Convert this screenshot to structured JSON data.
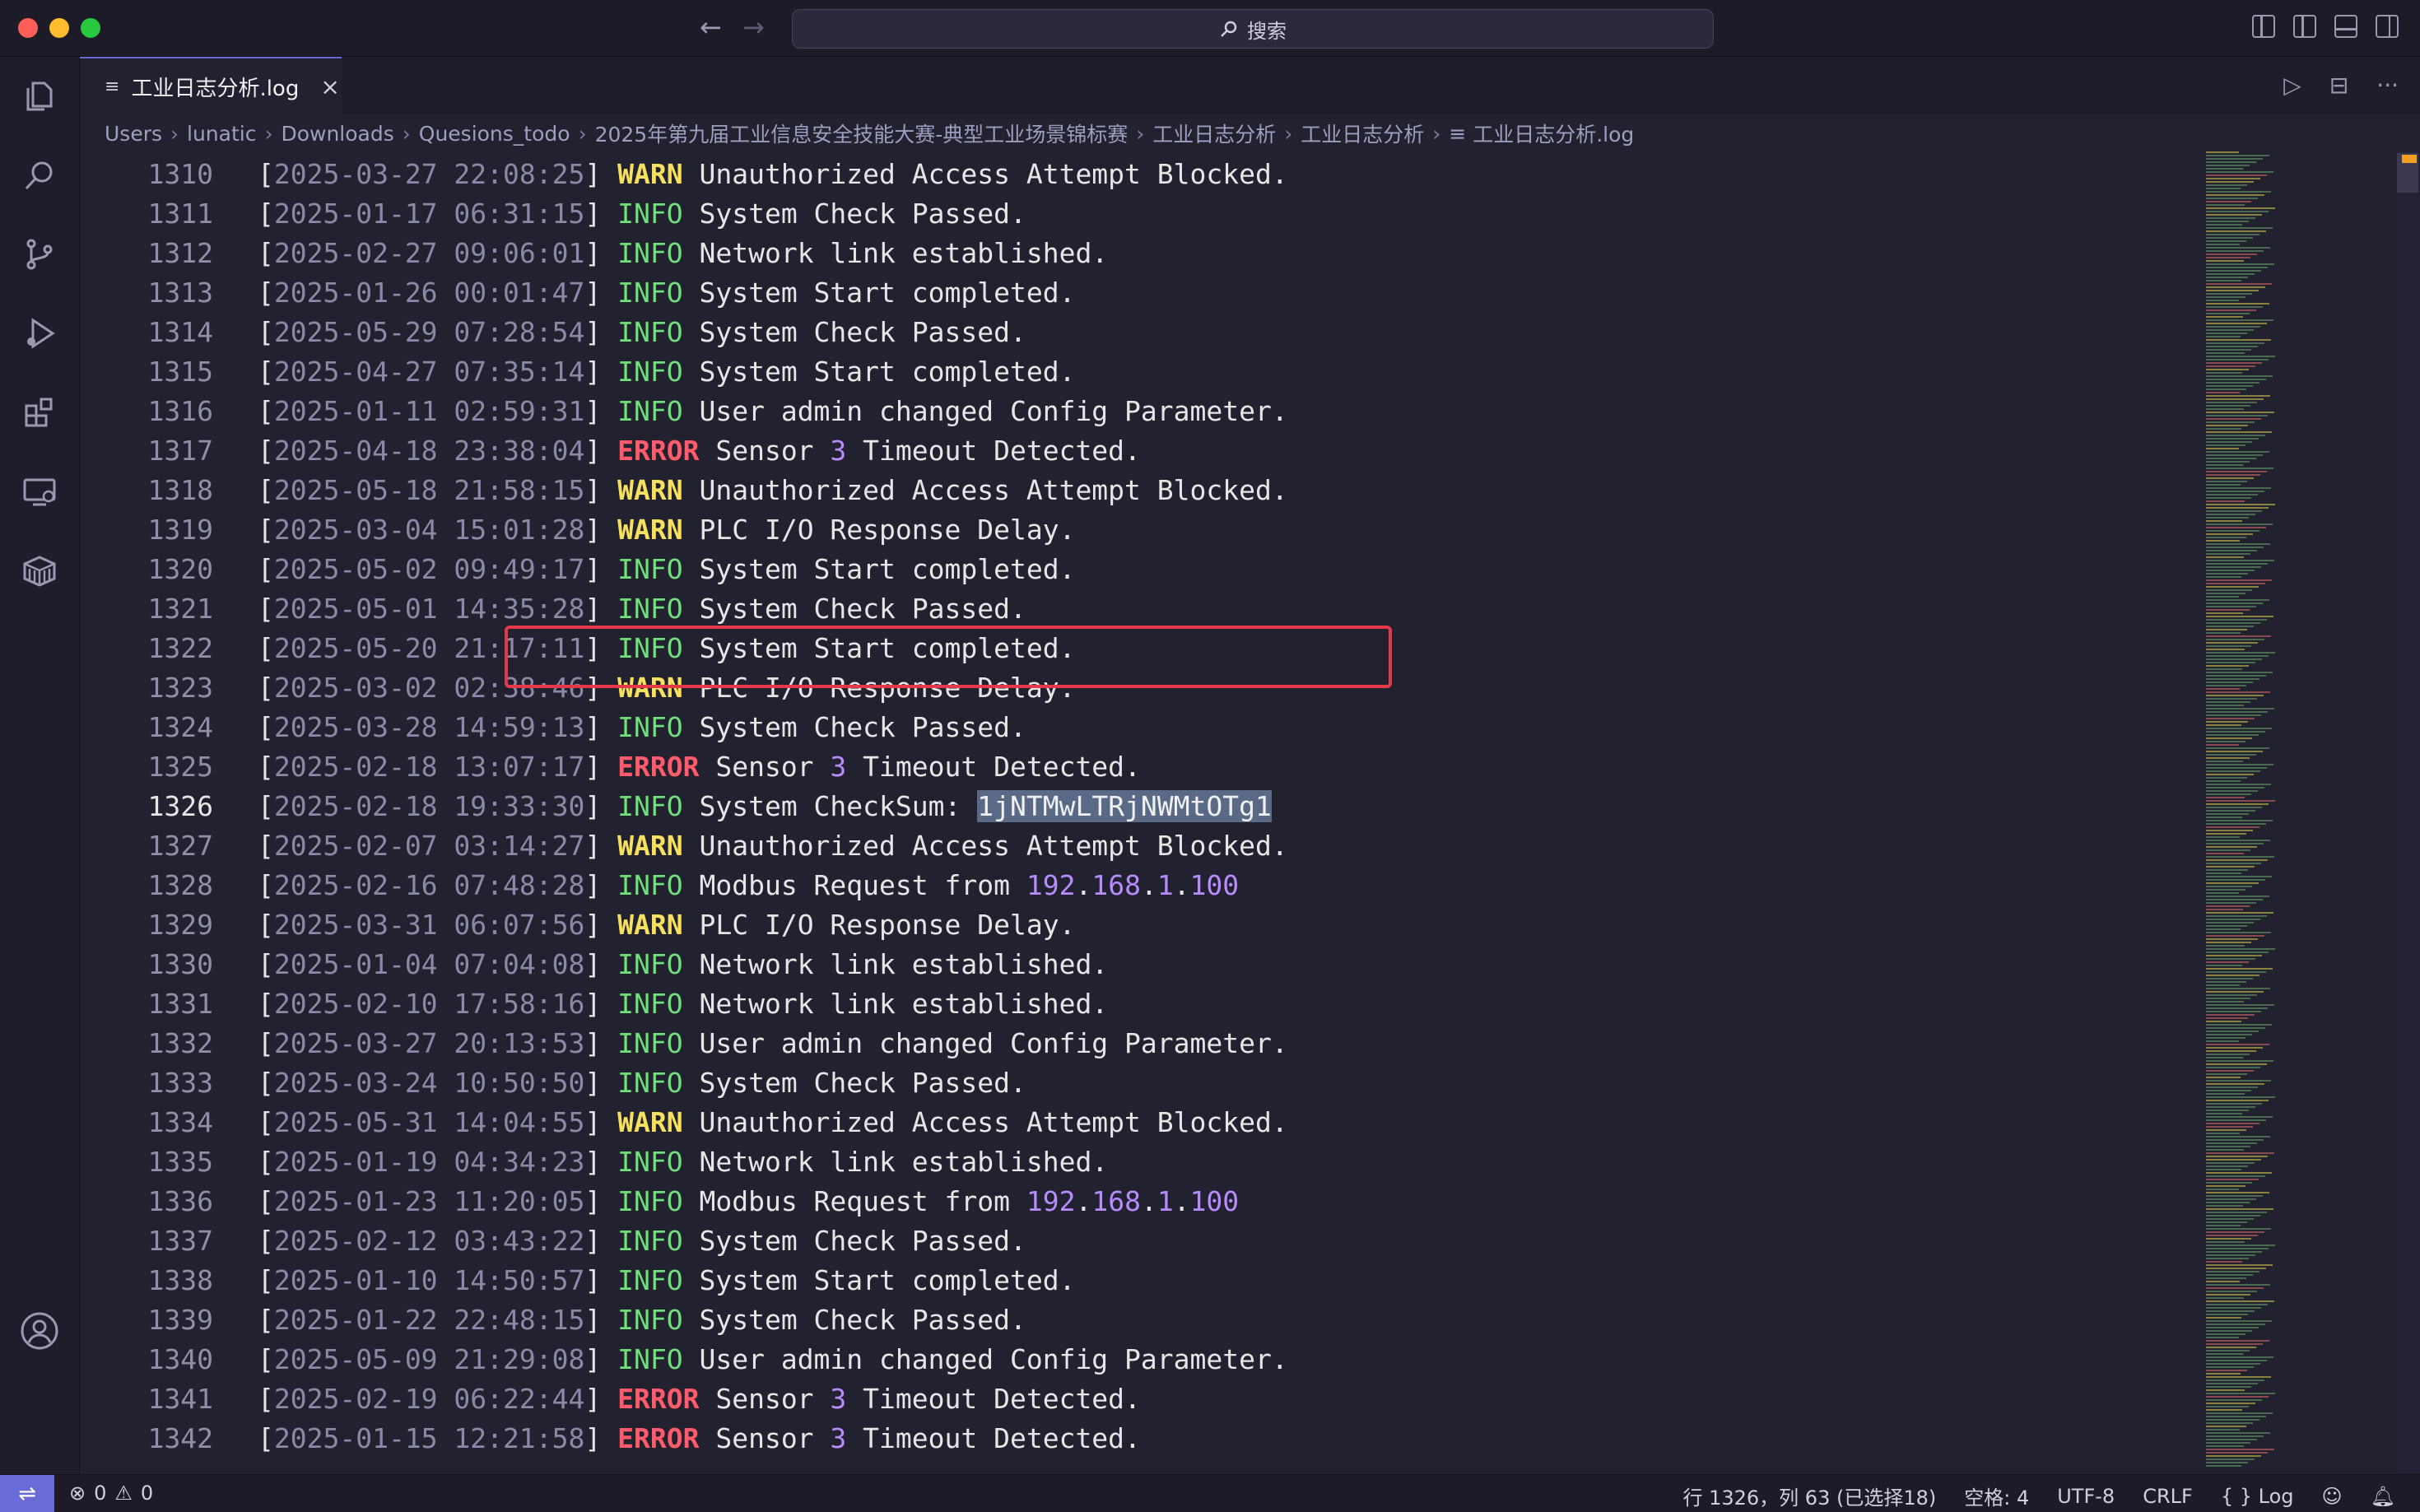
{
  "window": {
    "search_label": "搜索",
    "nav_back": "←",
    "nav_forward": "→"
  },
  "tab": {
    "title": "工业日志分析.log",
    "close": "×"
  },
  "breadcrumb": [
    "Users",
    "lunatic",
    "Downloads",
    "Quesions_todo",
    "2025年第九届工业信息安全技能大赛-典型工业场景锦标赛",
    "工业日志分析",
    "工业日志分析",
    "工业日志分析.log"
  ],
  "editor": {
    "lines": [
      {
        "n": "1310",
        "ts": "2025-03-27 22:08:25",
        "level": "WARN",
        "msg": "Unauthorized Access Attempt Blocked."
      },
      {
        "n": "1311",
        "ts": "2025-01-17 06:31:15",
        "level": "INFO",
        "msg": "System Check Passed."
      },
      {
        "n": "1312",
        "ts": "2025-02-27 09:06:01",
        "level": "INFO",
        "msg": "Network link established."
      },
      {
        "n": "1313",
        "ts": "2025-01-26 00:01:47",
        "level": "INFO",
        "msg": "System Start completed."
      },
      {
        "n": "1314",
        "ts": "2025-05-29 07:28:54",
        "level": "INFO",
        "msg": "System Check Passed."
      },
      {
        "n": "1315",
        "ts": "2025-04-27 07:35:14",
        "level": "INFO",
        "msg": "System Start completed."
      },
      {
        "n": "1316",
        "ts": "2025-01-11 02:59:31",
        "level": "INFO",
        "msg": "User admin changed Config Parameter."
      },
      {
        "n": "1317",
        "ts": "2025-04-18 23:38:04",
        "level": "ERROR",
        "msg": "Sensor 3 Timeout Detected."
      },
      {
        "n": "1318",
        "ts": "2025-05-18 21:58:15",
        "level": "WARN",
        "msg": "Unauthorized Access Attempt Blocked."
      },
      {
        "n": "1319",
        "ts": "2025-03-04 15:01:28",
        "level": "WARN",
        "msg": "PLC I/O Response Delay."
      },
      {
        "n": "1320",
        "ts": "2025-05-02 09:49:17",
        "level": "INFO",
        "msg": "System Start completed."
      },
      {
        "n": "1321",
        "ts": "2025-05-01 14:35:28",
        "level": "INFO",
        "msg": "System Check Passed."
      },
      {
        "n": "1322",
        "ts": "2025-05-20 21:17:11",
        "level": "INFO",
        "msg": "System Start completed."
      },
      {
        "n": "1323",
        "ts": "2025-03-02 02:38:46",
        "level": "WARN",
        "msg": "PLC I/O Response Delay."
      },
      {
        "n": "1324",
        "ts": "2025-03-28 14:59:13",
        "level": "INFO",
        "msg": "System Check Passed."
      },
      {
        "n": "1325",
        "ts": "2025-02-18 13:07:17",
        "level": "ERROR",
        "msg": "Sensor 3 Timeout Detected."
      },
      {
        "n": "1326",
        "ts": "2025-02-18 19:33:30",
        "level": "INFO",
        "msg": "System CheckSum: ",
        "selected": "1jNTMwLTRjNWMtOTg1",
        "active": true
      },
      {
        "n": "1327",
        "ts": "2025-02-07 03:14:27",
        "level": "WARN",
        "msg": "Unauthorized Access Attempt Blocked."
      },
      {
        "n": "1328",
        "ts": "2025-02-16 07:48:28",
        "level": "INFO",
        "msg": "Modbus Request from 192.168.1.100"
      },
      {
        "n": "1329",
        "ts": "2025-03-31 06:07:56",
        "level": "WARN",
        "msg": "PLC I/O Response Delay."
      },
      {
        "n": "1330",
        "ts": "2025-01-04 07:04:08",
        "level": "INFO",
        "msg": "Network link established."
      },
      {
        "n": "1331",
        "ts": "2025-02-10 17:58:16",
        "level": "INFO",
        "msg": "Network link established."
      },
      {
        "n": "1332",
        "ts": "2025-03-27 20:13:53",
        "level": "INFO",
        "msg": "User admin changed Config Parameter."
      },
      {
        "n": "1333",
        "ts": "2025-03-24 10:50:50",
        "level": "INFO",
        "msg": "System Check Passed."
      },
      {
        "n": "1334",
        "ts": "2025-05-31 14:04:55",
        "level": "WARN",
        "msg": "Unauthorized Access Attempt Blocked."
      },
      {
        "n": "1335",
        "ts": "2025-01-19 04:34:23",
        "level": "INFO",
        "msg": "Network link established."
      },
      {
        "n": "1336",
        "ts": "2025-01-23 11:20:05",
        "level": "INFO",
        "msg": "Modbus Request from 192.168.1.100"
      },
      {
        "n": "1337",
        "ts": "2025-02-12 03:43:22",
        "level": "INFO",
        "msg": "System Check Passed."
      },
      {
        "n": "1338",
        "ts": "2025-01-10 14:50:57",
        "level": "INFO",
        "msg": "System Start completed."
      },
      {
        "n": "1339",
        "ts": "2025-01-22 22:48:15",
        "level": "INFO",
        "msg": "System Check Passed."
      },
      {
        "n": "1340",
        "ts": "2025-05-09 21:29:08",
        "level": "INFO",
        "msg": "User admin changed Config Parameter."
      },
      {
        "n": "1341",
        "ts": "2025-02-19 06:22:44",
        "level": "ERROR",
        "msg": "Sensor 3 Timeout Detected."
      },
      {
        "n": "1342",
        "ts": "2025-01-15 12:21:58",
        "level": "ERROR",
        "msg": "Sensor 3 Timeout Detected."
      }
    ]
  },
  "statusbar": {
    "errors": "0",
    "warnings": "0",
    "cursor": "行 1326，列 63 (已选择18)",
    "indent": "空格: 4",
    "encoding": "UTF-8",
    "eol": "CRLF",
    "language": "Log",
    "language_icon": "{ }"
  },
  "colors": {
    "warn": "#f5e15d",
    "info": "#6fe07a",
    "error": "#ff5b6b",
    "number": "#b78cff",
    "highlight_box": "#e5384a",
    "accent": "#6b6bd8"
  }
}
